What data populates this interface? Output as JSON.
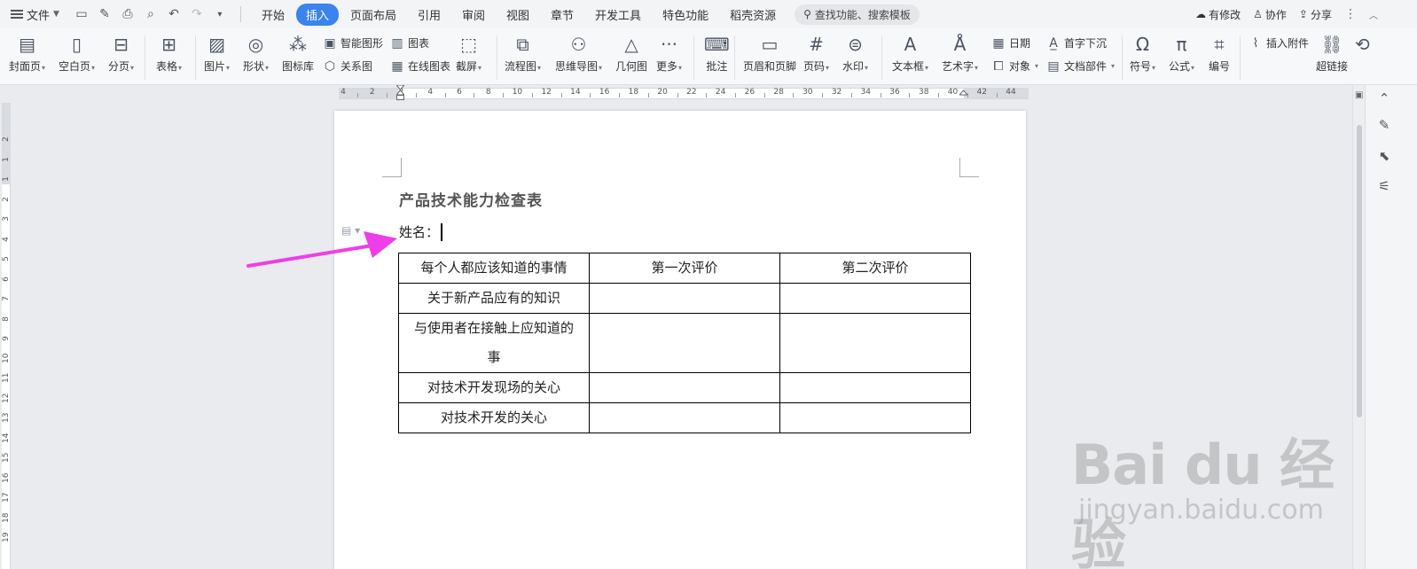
{
  "menubar": {
    "file_label": "文件",
    "tabs": [
      "开始",
      "插入",
      "页面布局",
      "引用",
      "审阅",
      "视图",
      "章节",
      "开发工具",
      "特色功能",
      "稻壳资源"
    ],
    "active_tab": "插入",
    "search_label": "查找功能、搜索模板",
    "right": {
      "changes": "有修改",
      "collab": "协作",
      "share": "分享"
    }
  },
  "ribbon": {
    "cover": "封面页",
    "blank": "空白页",
    "break": "分页",
    "table": "表格",
    "picture": "图片",
    "shape": "形状",
    "icon_lib": "图标库",
    "smart_shape": "智能图形",
    "chart": "图表",
    "relation": "关系图",
    "online_chart": "在线图表",
    "screenshot": "截屏",
    "flowchart": "流程图",
    "mindmap": "思维导图",
    "geometry": "几何图",
    "more": "更多",
    "comment": "批注",
    "header_footer": "页眉和页脚",
    "page_num": "页码",
    "watermark": "水印",
    "textbox": "文本框",
    "wordart": "艺术字",
    "date": "日期",
    "object": "对象",
    "dropcap": "首字下沉",
    "doc_parts": "文档部件",
    "symbol": "符号",
    "formula": "公式",
    "numbering": "编号",
    "attach": "插入附件",
    "hyperlink": "超链接"
  },
  "ruler": {
    "h_numbers": [
      "4",
      "2",
      "2",
      "4",
      "6",
      "8",
      "10",
      "12",
      "14",
      "16",
      "18",
      "20",
      "22",
      "24",
      "26",
      "28",
      "30",
      "32",
      "34",
      "36",
      "38",
      "40",
      "42",
      "44"
    ],
    "v_numbers": [
      "2",
      "1",
      "1",
      "2",
      "3",
      "4",
      "5",
      "6",
      "7",
      "8",
      "9",
      "10",
      "11",
      "12",
      "13",
      "14",
      "15",
      "16",
      "17",
      "18",
      "19"
    ]
  },
  "document": {
    "title": "产品技术能力检查表",
    "name_label": "姓名：",
    "table": {
      "headers": [
        "每个人都应该知道的事情",
        "第一次评价",
        "第二次评价"
      ],
      "rows": [
        [
          "关于新产品应有的知识",
          "",
          ""
        ],
        [
          "与使用者在接触上应知道的事",
          "",
          ""
        ],
        [
          "对技术开发现场的关心",
          "",
          ""
        ],
        [
          "对技术开发的关心",
          "",
          ""
        ]
      ]
    }
  },
  "annotation": {
    "arrow_color": "#ee3ee8"
  },
  "watermark": {
    "logo": "Bai du 经验",
    "url": "jingyan.baidu.com"
  },
  "colors": {
    "accent": "#3b83ee",
    "ribbon_bg": "#f7f8fa"
  }
}
